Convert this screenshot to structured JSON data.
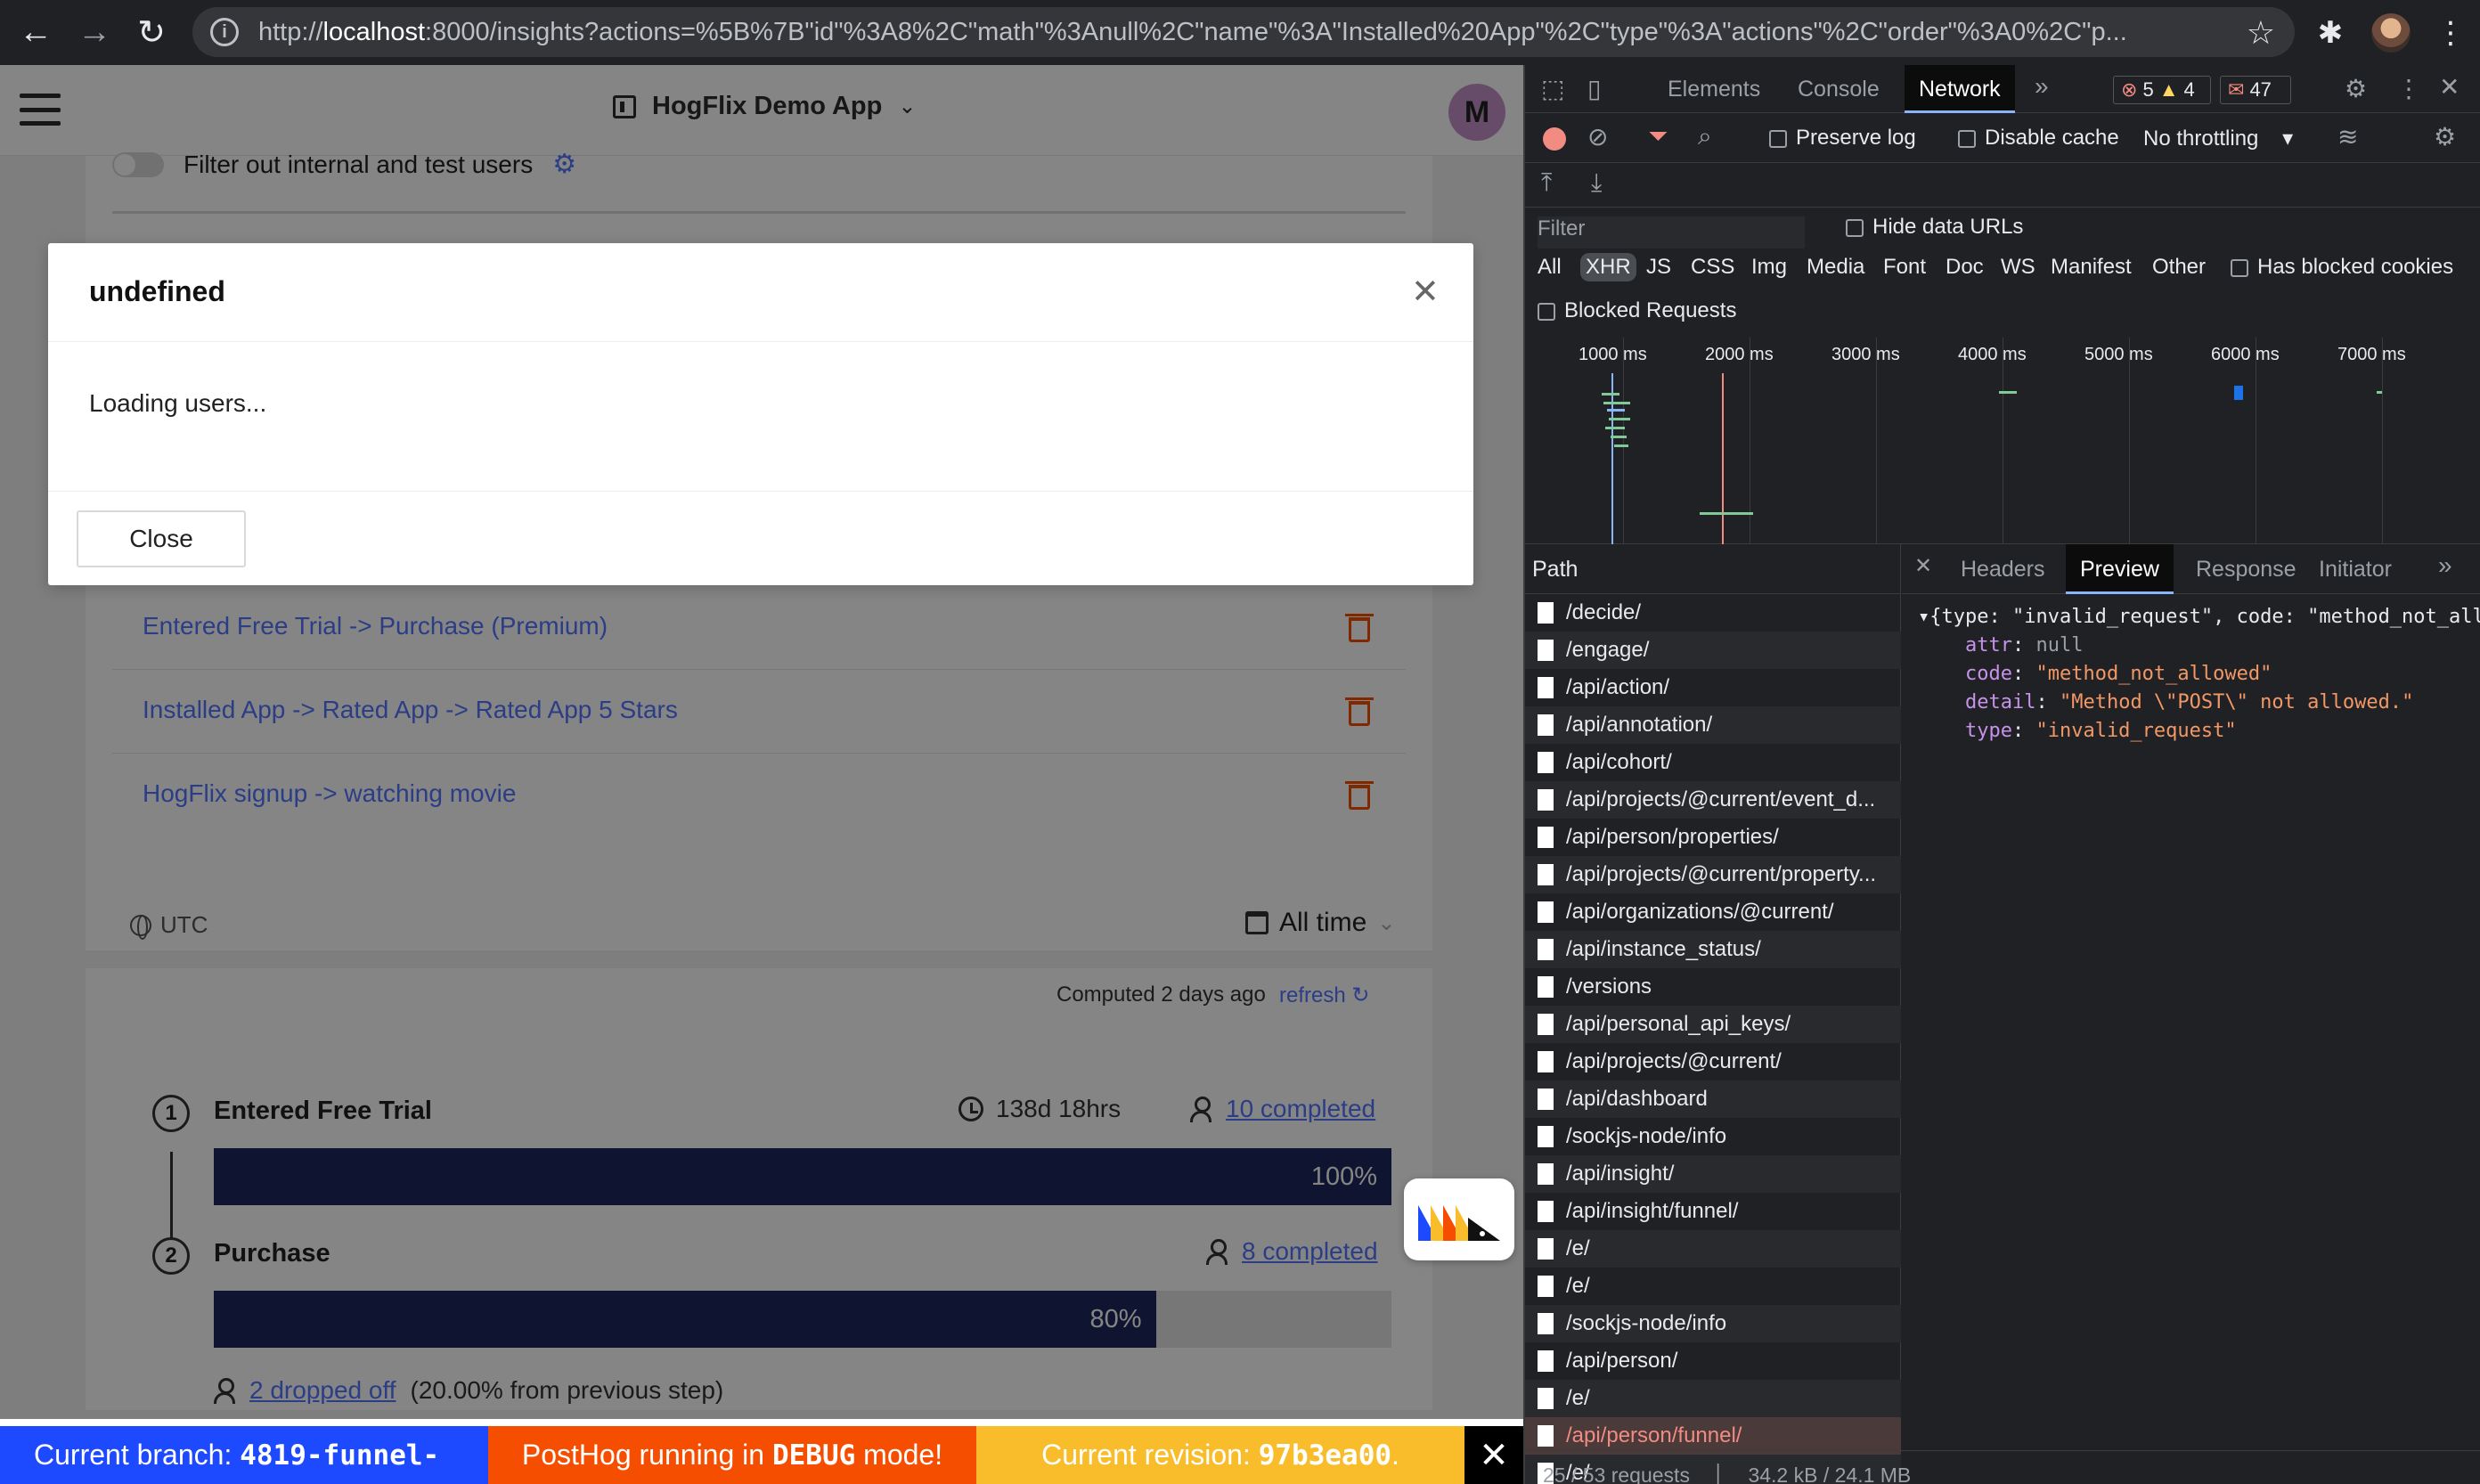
{
  "browser": {
    "url_prefix": "http://",
    "url_host": "localhost",
    "url_rest": ":8000/insights?actions=%5B%7B\"id\"%3A8%2C\"math\"%3Anull%2C\"name\"%3A\"Installed%20App\"%2C\"type\"%3A\"actions\"%2C\"order\"%3A0%2C\"p..."
  },
  "app": {
    "project_name": "HogFlix Demo App",
    "user_initial": "M",
    "filter_label": "Filter out internal and test users",
    "funnel_links": [
      "Entered Free Trial -> Purchase (Premium)",
      "Installed App -> Rated App -> Rated App 5 Stars",
      "HogFlix signup -> watching movie"
    ],
    "timezone": "UTC",
    "date_range": "All time",
    "computed": "Computed 2 days ago",
    "refresh": "refresh",
    "steps": [
      {
        "num": "1",
        "title": "Entered Free Trial",
        "time": "138d 18hrs",
        "completed": "10 completed",
        "percent": "100%",
        "fill": 100
      },
      {
        "num": "2",
        "title": "Purchase",
        "completed": "8 completed",
        "percent": "80%",
        "fill": 80
      }
    ],
    "dropped_link": "2 dropped off",
    "dropped_rest": "(20.00% from previous step)"
  },
  "modal": {
    "title": "undefined",
    "body": "Loading users...",
    "close_label": "Close"
  },
  "banners": {
    "branch_label": "Current branch:",
    "branch_value": "4819-funnel-",
    "debug_pre": "PostHog running in",
    "debug_code": "DEBUG",
    "debug_post": "mode!",
    "revision_label": "Current revision:",
    "revision_value": "97b3ea00",
    "revision_dot": "."
  },
  "devtools": {
    "tabs": [
      "Elements",
      "Console",
      "Network"
    ],
    "errors": "5",
    "warnings": "4",
    "messages": "47",
    "preserve_log": "Preserve log",
    "disable_cache": "Disable cache",
    "throttling": "No throttling",
    "filter_placeholder": "Filter",
    "hide_data_urls": "Hide data URLs",
    "types": [
      "All",
      "XHR",
      "JS",
      "CSS",
      "Img",
      "Media",
      "Font",
      "Doc",
      "WS",
      "Manifest",
      "Other"
    ],
    "has_blocked_cookies": "Has blocked cookies",
    "blocked_requests": "Blocked Requests",
    "timeline_labels": [
      "1000 ms",
      "2000 ms",
      "3000 ms",
      "4000 ms",
      "5000 ms",
      "6000 ms",
      "7000 ms"
    ],
    "path_header": "Path",
    "paths": [
      "/decide/",
      "/engage/",
      "/api/action/",
      "/api/annotation/",
      "/api/cohort/",
      "/api/projects/@current/event_d...",
      "/api/person/properties/",
      "/api/projects/@current/property...",
      "/api/organizations/@current/",
      "/api/instance_status/",
      "/versions",
      "/api/personal_api_keys/",
      "/api/projects/@current/",
      "/api/dashboard",
      "/sockjs-node/info",
      "/api/insight/",
      "/api/insight/funnel/",
      "/e/",
      "/e/",
      "/sockjs-node/info",
      "/api/person/",
      "/e/",
      "/api/person/funnel/",
      "/e/"
    ],
    "error_path_index": 22,
    "footer_requests": "25 / 53 requests",
    "footer_size": "34.2 kB / 24.1 MB",
    "detail_tabs": [
      "Headers",
      "Preview",
      "Response",
      "Initiator"
    ],
    "json_summary": "{type: \"invalid_request\", code: \"method_not_allowed\"",
    "json": {
      "attr": "null",
      "code": "\"method_not_allowed\"",
      "detail": "\"Method \\\"POST\\\" not allowed.\"",
      "type": "\"invalid_request\""
    }
  }
}
